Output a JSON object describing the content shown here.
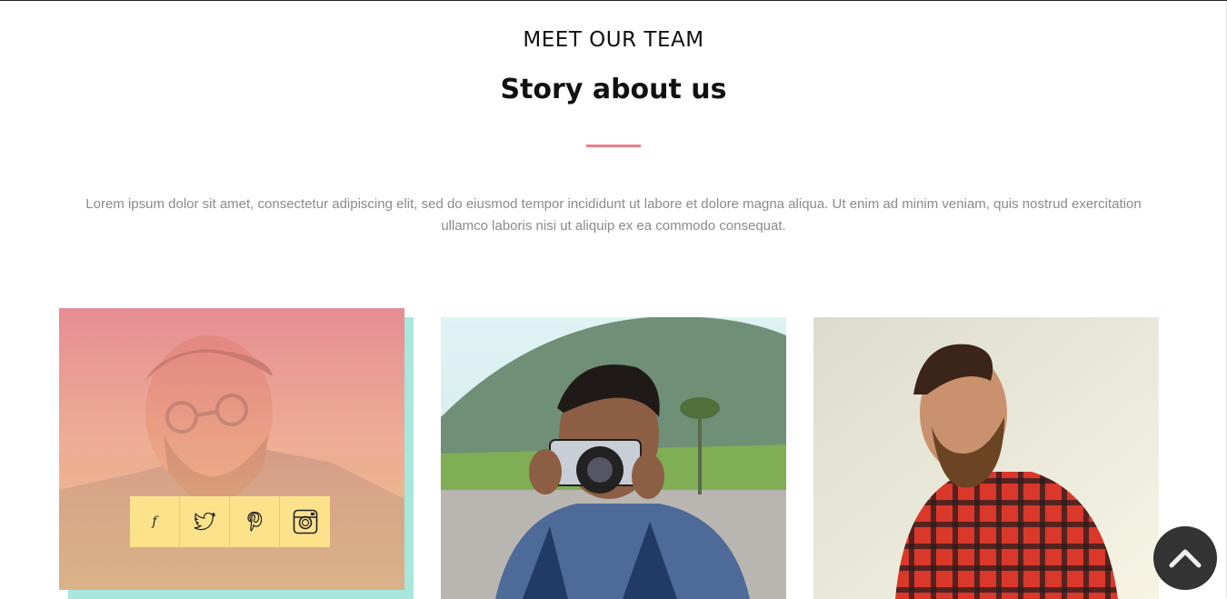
{
  "section": {
    "eyebrow": "MEET OUR TEAM",
    "title": "Story about us",
    "description": "Lorem ipsum dolor sit amet, consectetur adipiscing elit, sed do eiusmod tempor incididunt ut labore et dolore magna aliqua. Ut enim ad minim veniam, quis nostrud exercitation ullamco laboris nisi ut aliquip ex ea commodo consequat."
  },
  "team": [
    {
      "photo": "man-with-glasses-beard-photo",
      "social": [
        "facebook-icon",
        "twitter-icon",
        "pinterest-icon",
        "instagram-icon"
      ],
      "social_labels": [
        "f"
      ]
    },
    {
      "photo": "man-with-camera-photo"
    },
    {
      "photo": "bearded-man-plaid-shirt-photo"
    }
  ],
  "colors": {
    "accent": "#ea7f86",
    "card_overlay_top": "#ea7c88",
    "card_overlay_bottom": "#f7c48c",
    "social_bg": "#fde28c",
    "card_shadow": "#a9e6dc",
    "scroll_btn": "#333333"
  },
  "scroll_top": {
    "icon": "chevron-up-icon"
  }
}
